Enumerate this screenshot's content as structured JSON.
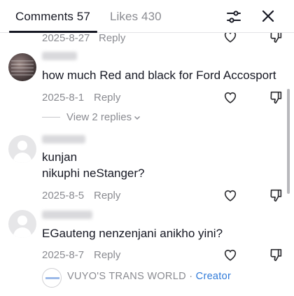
{
  "tabs": {
    "comments": "Comments 57",
    "likes": "Likes 430"
  },
  "icons": {
    "filter": "sliders-icon",
    "close": "close-icon",
    "like": "heart-outline-icon",
    "dislike": "thumbs-down-outline-icon",
    "chevron": "chevron-down-icon"
  },
  "colors": {
    "text": "#161823",
    "muted": "#8a8b91",
    "creator": "#2f7ad9"
  },
  "comments": [
    {
      "date": "2025-8-27",
      "reply_label": "Reply"
    },
    {
      "text": "how much Red and black for Ford Accosport",
      "date": "2025-8-1",
      "reply_label": "Reply",
      "view_replies": "View 2 replies"
    },
    {
      "text_line1": "kunjan",
      "text_line2": "nikuphi neStanger?",
      "date": "2025-8-5",
      "reply_label": "Reply"
    },
    {
      "text": "EGauteng nenzenjani anikho yini?",
      "date": "2025-8-7",
      "reply_label": "Reply"
    }
  ],
  "creator_reply": {
    "name": "VUYO'S TRANS WORLD",
    "separator": "·",
    "badge": "Creator"
  }
}
